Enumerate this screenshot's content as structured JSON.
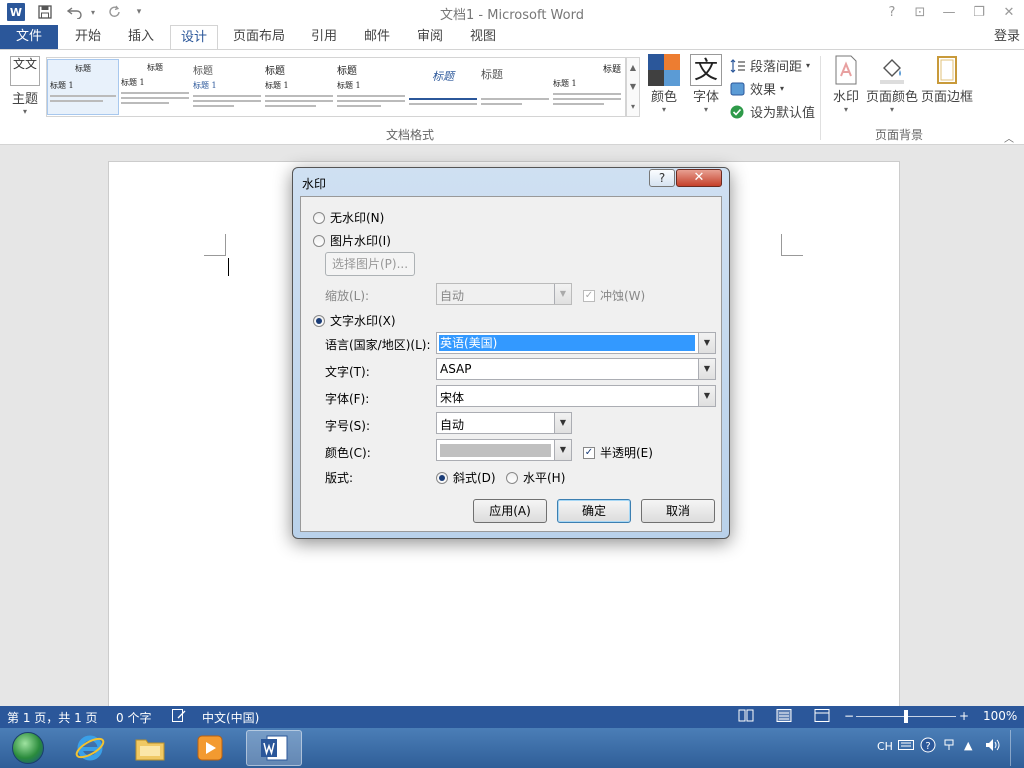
{
  "window": {
    "title": "文档1 - Microsoft Word",
    "app_badge": "W",
    "help": "?",
    "ribbon_opts": "⊡",
    "minimize": "—",
    "restore": "❐",
    "close": "✕"
  },
  "tabs": {
    "file": "文件",
    "home": "开始",
    "insert": "插入",
    "design": "设计",
    "layout": "页面布局",
    "references": "引用",
    "mailings": "邮件",
    "review": "审阅",
    "view": "视图",
    "login": "登录"
  },
  "ribbon": {
    "theme": "主题",
    "theme_icon": "文文",
    "style_thumbs": [
      "标题",
      "标题",
      "标题",
      "标题",
      "标题",
      "标题",
      "标题",
      "标题"
    ],
    "gallery_title_sample": "标题 1",
    "group_doc_format": "文档格式",
    "colors": "颜色",
    "fonts": "字体",
    "fonts_glyph": "文",
    "paragraph_spacing": "段落间距",
    "effects": "效果",
    "set_default": "设为默认值",
    "watermark": "水印",
    "page_color": "页面颜色",
    "page_borders": "页面边框",
    "group_page_bg": "页面背景",
    "theme_colors": [
      "#2b579a",
      "#ed7d31",
      "#404040",
      "#5b9bd5"
    ]
  },
  "dialog": {
    "title": "水印",
    "help": "?",
    "close": "✕",
    "no_watermark": "无水印(N)",
    "picture_watermark": "图片水印(I)",
    "select_picture": "选择图片(P)...",
    "scale_label": "缩放(L):",
    "scale_value": "自动",
    "washout": "冲蚀(W)",
    "text_watermark": "文字水印(X)",
    "language_label": "语言(国家/地区)(L):",
    "language_value": "英语(美国)",
    "text_label": "文字(T):",
    "text_value": "ASAP",
    "font_label": "字体(F):",
    "font_value": "宋体",
    "size_label": "字号(S):",
    "size_value": "自动",
    "color_label": "颜色(C):",
    "semi_transparent": "半透明(E)",
    "layout_label": "版式:",
    "diagonal": "斜式(D)",
    "horizontal": "水平(H)",
    "apply": "应用(A)",
    "ok": "确定",
    "cancel": "取消",
    "swatch_color": "#c0c0c0"
  },
  "statusbar": {
    "page": "第 1 页，共 1 页",
    "words": "0 个字",
    "language": "中文(中国)",
    "zoom": "100%",
    "zoom_minus": "−",
    "zoom_plus": "+"
  },
  "taskbar": {
    "ime": "CH"
  }
}
